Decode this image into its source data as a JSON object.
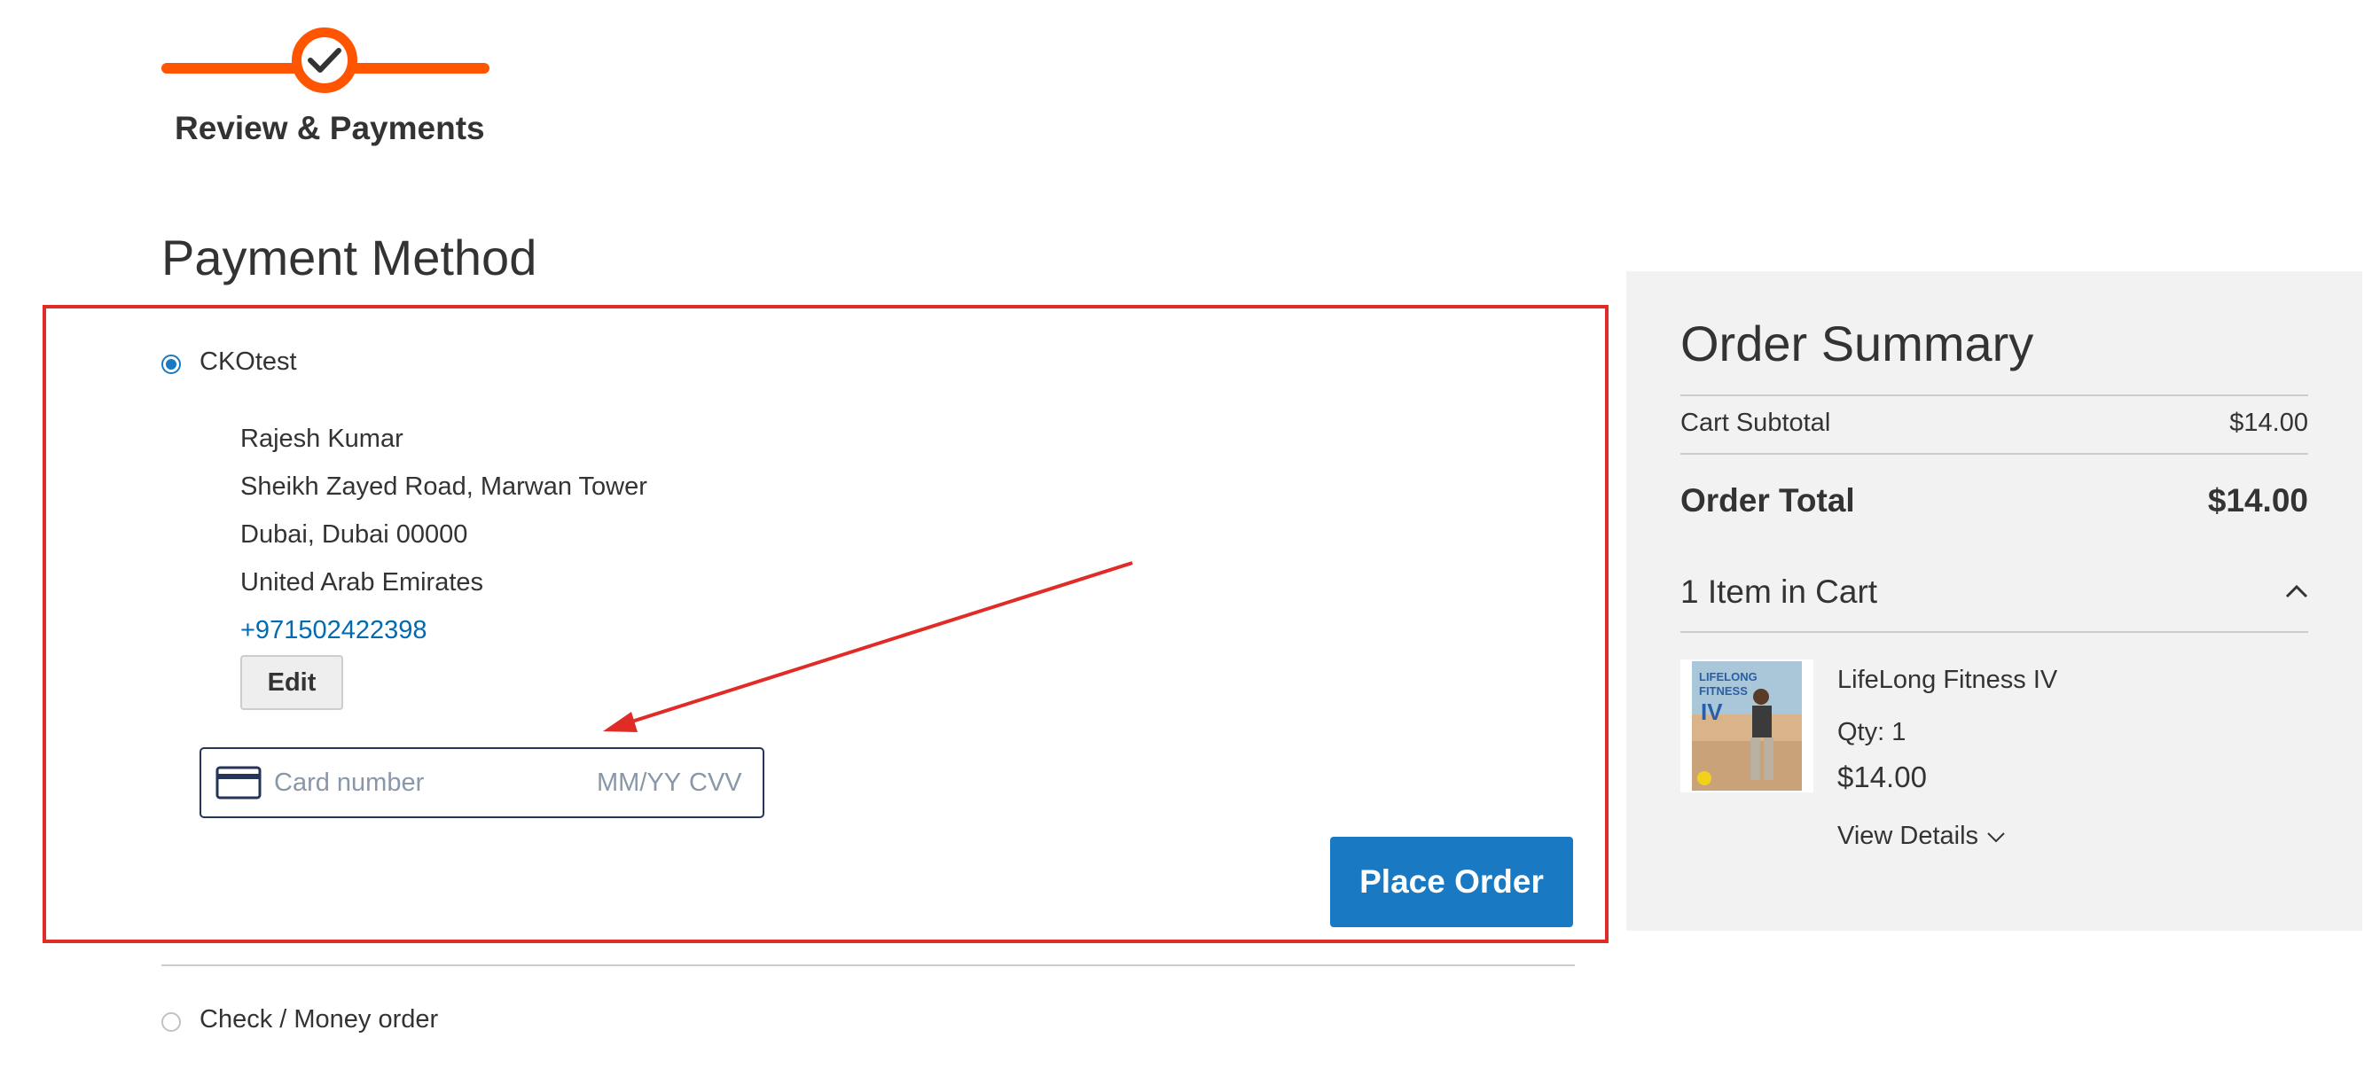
{
  "progress": {
    "step_label": "Review & Payments",
    "accent": "#ff5501"
  },
  "payment": {
    "title": "Payment Method",
    "methods": [
      {
        "label": "CKOtest",
        "selected": true
      },
      {
        "label": "Check / Money order",
        "selected": false
      }
    ],
    "address": {
      "name": "Rajesh Kumar",
      "street": "Sheikh Zayed Road, Marwan Tower",
      "city": "Dubai, Dubai 00000",
      "country": "United Arab Emirates",
      "phone": "+971502422398"
    },
    "edit_label": "Edit",
    "card": {
      "number_placeholder": "Card number",
      "expiry_placeholder": "MM/YY",
      "cvv_placeholder": "CVV",
      "icon": "credit-card-icon"
    },
    "place_order_label": "Place Order",
    "primary_color": "#1979c3"
  },
  "summary": {
    "title": "Order Summary",
    "subtotal_label": "Cart Subtotal",
    "subtotal_value": "$14.00",
    "total_label": "Order Total",
    "total_value": "$14.00",
    "items_label": "1 Item in Cart",
    "item": {
      "name": "LifeLong Fitness IV",
      "qty": "Qty: 1",
      "price": "$14.00",
      "details_label": "View Details",
      "thumb_text": "LIFELONG FITNESS IV"
    }
  },
  "annotation": {
    "box_color": "#e02b27"
  }
}
